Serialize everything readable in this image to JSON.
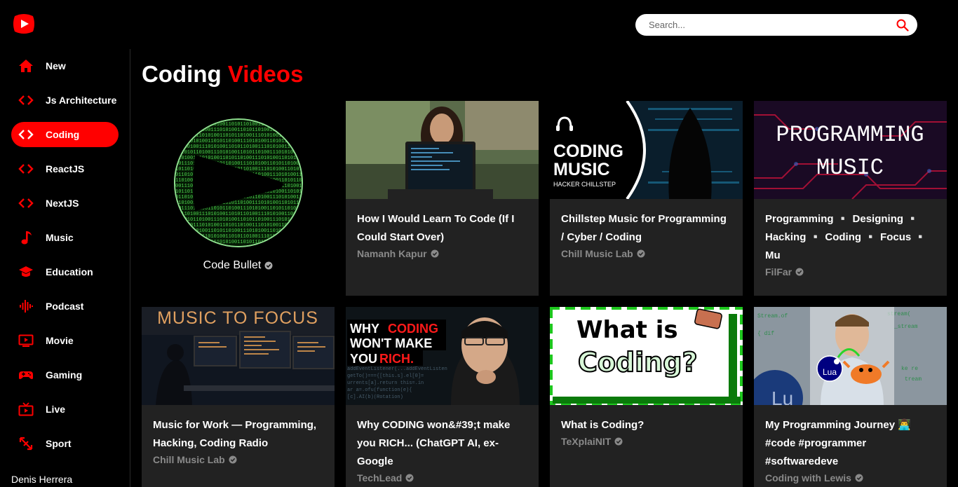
{
  "search": {
    "placeholder": "Search..."
  },
  "sidebar": {
    "items": [
      {
        "label": "New",
        "icon": "home-icon"
      },
      {
        "label": "Js Architecture",
        "icon": "code-icon"
      },
      {
        "label": "Coding",
        "icon": "code-icon",
        "active": true
      },
      {
        "label": "ReactJS",
        "icon": "code-icon"
      },
      {
        "label": "NextJS",
        "icon": "code-icon"
      },
      {
        "label": "Music",
        "icon": "music-note-icon"
      },
      {
        "label": "Education",
        "icon": "graduation-cap-icon"
      },
      {
        "label": "Podcast",
        "icon": "podcast-waveform-icon"
      },
      {
        "label": "Movie",
        "icon": "tv-icon"
      },
      {
        "label": "Gaming",
        "icon": "gamepad-icon"
      },
      {
        "label": "Live",
        "icon": "live-tv-icon"
      },
      {
        "label": "Sport",
        "icon": "sport-arrows-icon"
      }
    ],
    "user_name": "Denis Herrera"
  },
  "page": {
    "title_main": "Coding",
    "title_accent": "Videos"
  },
  "channel": {
    "name": "Code Bullet",
    "verified": true
  },
  "videos": [
    {
      "title": "How I Would Learn To Code (If I Could Start Over)",
      "channel": "Namanh Kapur"
    },
    {
      "title": "Chillstep Music for Programming / Cyber / Coding",
      "channel": "Chill Music Lab",
      "thumb_text_1": "CODING",
      "thumb_text_2": "MUSIC",
      "thumb_text_3": "HACKER CHILLSTEP"
    },
    {
      "title": "Programming ▫️ Designing ▫️ Hacking ▫️ Coding ▫️ Focus ▫️ Mu",
      "channel": "FilFar",
      "thumb_text_1": "PROGRAMMING",
      "thumb_text_2": "MUSIC"
    },
    {
      "title": "Music for Work — Programming, Hacking, Coding Radio",
      "channel": "Chill Music Lab",
      "thumb_text_1": "MUSIC TO FOCUS"
    },
    {
      "title": "Why CODING won&#39;t make you RICH... (ChatGPT AI, ex-Google",
      "channel": "TechLead",
      "thumb_text_1": "WHY",
      "thumb_text_2": "CODING",
      "thumb_text_3": "WON'T MAKE",
      "thumb_text_4": "YOU",
      "thumb_text_5": "RICH."
    },
    {
      "title": "What is Coding?",
      "channel": "TeXplaiNIT",
      "thumb_text_1": "What is",
      "thumb_text_2": "Coding?"
    },
    {
      "title": "My Programming Journey 👨‍💻 #code #programmer #softwaredeve",
      "channel": "Coding with Lewis",
      "thumb_text_1": "Lua",
      "thumb_text_2": "Lu"
    }
  ],
  "colors": {
    "accent": "#ff0000",
    "card_bg": "#222222",
    "channel_text": "#8a8a8a"
  }
}
